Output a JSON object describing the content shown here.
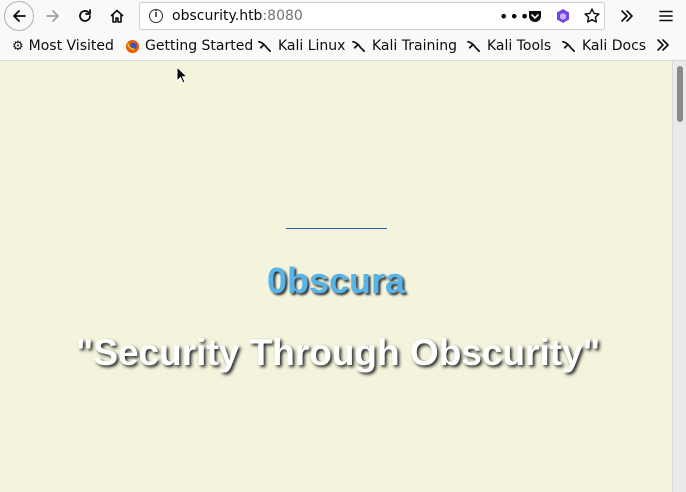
{
  "browser": {
    "url_host": "obscurity.htb",
    "url_port": ":8080",
    "bookmarks": [
      {
        "label": "Most Visited",
        "icon": "gear-icon"
      },
      {
        "label": "Getting Started",
        "icon": "firefox-icon"
      },
      {
        "label": "Kali Linux",
        "icon": "kali-dragon-icon"
      },
      {
        "label": "Kali Training",
        "icon": "kali-dragon-icon"
      },
      {
        "label": "Kali Tools",
        "icon": "kali-dragon-icon"
      },
      {
        "label": "Kali Docs",
        "icon": "kali-dragon-icon"
      }
    ]
  },
  "page": {
    "title": "0bscura",
    "tagline": "\"Security Through Obscurity\""
  },
  "colors": {
    "page_background": "#f4f4dc",
    "title_color": "#56b4e8",
    "divider_color": "#2f60b5"
  }
}
